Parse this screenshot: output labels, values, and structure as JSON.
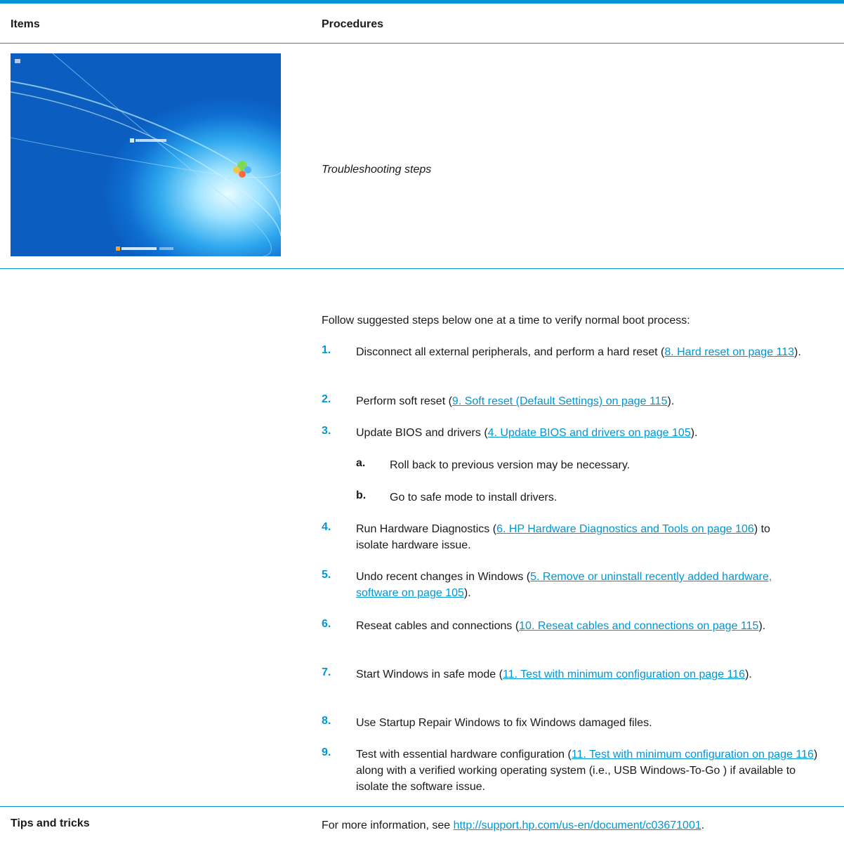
{
  "table": {
    "header_items": "Items",
    "header_procedures": "Procedures"
  },
  "subheading": "Troubleshooting steps",
  "intro": "Follow suggested steps below one at a time to verify normal boot process:",
  "steps": [
    {
      "num": "1.",
      "before": "Disconnect all external peripherals, and perform a hard reset (",
      "link": "8. Hard reset on page 113",
      "after": ")."
    },
    {
      "num": "2.",
      "before": "Perform soft reset (",
      "link": "9. Soft reset (Default Settings) on page 115",
      "after": ")."
    },
    {
      "num": "3.",
      "before": "Update BIOS and drivers (",
      "link": "4. Update BIOS and drivers on page 105",
      "after": ")."
    },
    {
      "num": "4.",
      "before": "Run Hardware Diagnostics (",
      "link": "6. HP Hardware Diagnostics and Tools on page 106",
      "after": ") to isolate hardware issue."
    },
    {
      "num": "5.",
      "before": "Undo recent changes in Windows (",
      "link": "5. Remove or uninstall recently added hardware, software on page 105",
      "after": ")."
    },
    {
      "num": "6.",
      "before": "Reseat cables and connections (",
      "link": "10. Reseat cables and connections on page 115",
      "after": ")."
    },
    {
      "num": "7.",
      "before": "Start Windows in safe mode (",
      "link": "11. Test with minimum configuration on page 116",
      "after": ")."
    },
    {
      "num": "8.",
      "before": "Use Startup Repair Windows to fix Windows damaged files.",
      "link": "",
      "after": ""
    },
    {
      "num": "9.",
      "before": "Test with essential hardware configuration (",
      "link": "11. Test with minimum configuration on page 116",
      "after": ") along with a verified working operating system (i.e., USB Windows-To-Go ) if available to isolate the software issue."
    }
  ],
  "substeps": [
    {
      "letter": "a.",
      "text": "Roll back to previous version may be necessary."
    },
    {
      "letter": "b.",
      "text": "Go to safe mode to install drivers."
    }
  ],
  "tips": {
    "label": "Tips and tricks",
    "before": "For more information, see ",
    "link": "http://support.hp.com/us-en/document/c03671001",
    "after": "."
  },
  "colors": {
    "accent": "#0096d6",
    "text": "#1a1a1a"
  },
  "icons": {
    "screenshot": "windows-startup-screen-image"
  }
}
